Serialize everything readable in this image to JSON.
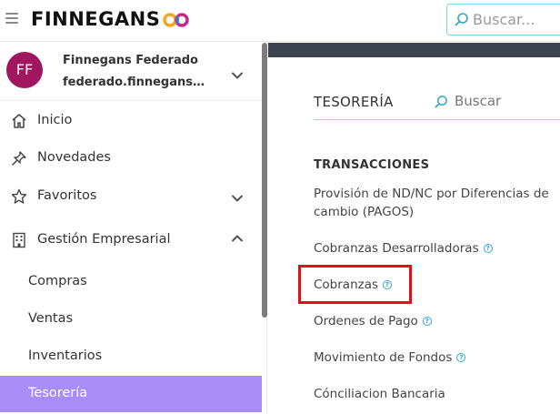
{
  "app": {
    "logo_text": "FINNEGANS",
    "search_placeholder": "Buscar..."
  },
  "user": {
    "initials": "FF",
    "name": "Finnegans Federado",
    "email": "federado.finnegans@finnegans.com.ar",
    "avatar_color": "#a0165f"
  },
  "sidebar": {
    "items": [
      {
        "label": "Inicio",
        "icon": "home-icon"
      },
      {
        "label": "Novedades",
        "icon": "pin-icon"
      },
      {
        "label": "Favoritos",
        "icon": "star-icon"
      },
      {
        "label": "Gestión Empresarial",
        "icon": "building-icon"
      }
    ],
    "sub_items": [
      {
        "label": "Compras"
      },
      {
        "label": "Ventas"
      },
      {
        "label": "Inventarios"
      },
      {
        "label": "Tesorería",
        "active": true
      }
    ],
    "active_color": "#a98cf5"
  },
  "main": {
    "title": "TESORERÍA",
    "search_placeholder": "Buscar",
    "section_title": "TRANSACCIONES",
    "links": [
      {
        "label": "Provisión de ND/NC por Diferencias de cambio (PAGOS)",
        "help": false
      },
      {
        "label": "Cobranzas Desarrolladoras",
        "help": true
      },
      {
        "label": "Cobranzas",
        "help": true,
        "highlighted": true
      },
      {
        "label": "Ordenes de Pago",
        "help": true
      },
      {
        "label": "Movimiento de Fondos",
        "help": true
      },
      {
        "label": "Cónciliacion Bancaria",
        "help": false
      }
    ],
    "help_glyph": "?",
    "highlight_color": "#e0101a"
  }
}
